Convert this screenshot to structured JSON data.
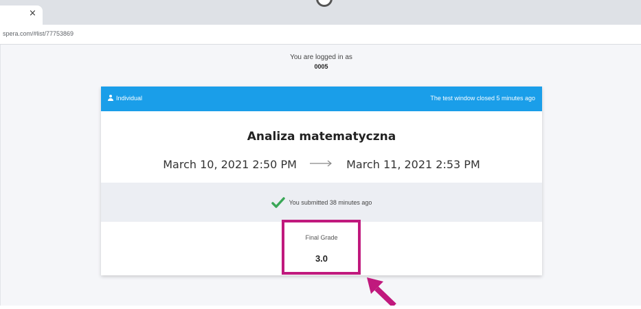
{
  "browser": {
    "tab_close": "×",
    "url": "spera.com/#list/77753869"
  },
  "login": {
    "prefix": "You are logged in as",
    "user": "0005"
  },
  "card": {
    "mode_label": "Individual",
    "window_status": "The test window closed 5 minutes ago",
    "title": "Analiza matematyczna",
    "start": "March 10, 2021 2:50 PM",
    "end": "March 11, 2021 2:53 PM",
    "submission_status": "You submitted 38 minutes ago",
    "grade_label": "Final Grade",
    "grade_value": "3.0"
  },
  "colors": {
    "header": "#1a9ee9",
    "check": "#3aa757",
    "annotation": "#c0197d"
  },
  "icons": [
    "close-icon",
    "user-icon",
    "arrow-right-icon",
    "checkmark-icon",
    "annotation-arrow-icon"
  ]
}
